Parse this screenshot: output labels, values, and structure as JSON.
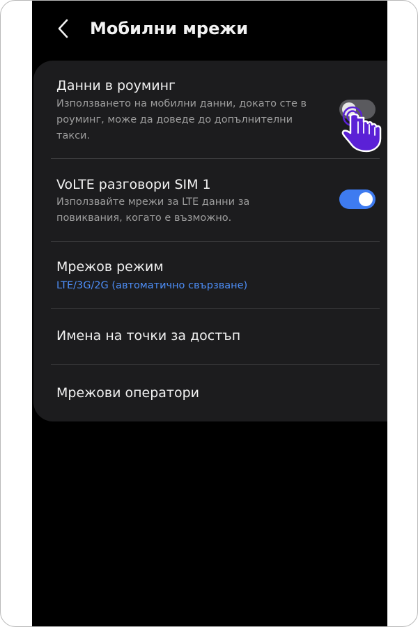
{
  "header": {
    "back_icon": "chevron-left-icon",
    "title": "Мобилни мрежи"
  },
  "settings": {
    "items": [
      {
        "title": "Данни в роуминг",
        "description": "Използването на мобилни данни, докато сте в роуминг, може да доведе до допълнителни такси.",
        "toggle_state": "off"
      },
      {
        "title": "VoLTE разговори SIM 1",
        "description": "Използвайте мрежи за LTE данни за повиквания, когато е възможно.",
        "toggle_state": "on"
      },
      {
        "title": "Мрежов режим",
        "subtitle": "LTE/3G/2G (автоматично свързване)"
      },
      {
        "title": "Имена на точки за достъп"
      },
      {
        "title": "Мрежови оператори"
      }
    ]
  },
  "overlay": {
    "pointer_icon": "tap-hand-icon"
  },
  "colors": {
    "background": "#000000",
    "card": "#1c1c1e",
    "accent": "#3e7bf0",
    "subtitle_link": "#4d8ef7",
    "hand_pointer": "#5b21d6"
  }
}
